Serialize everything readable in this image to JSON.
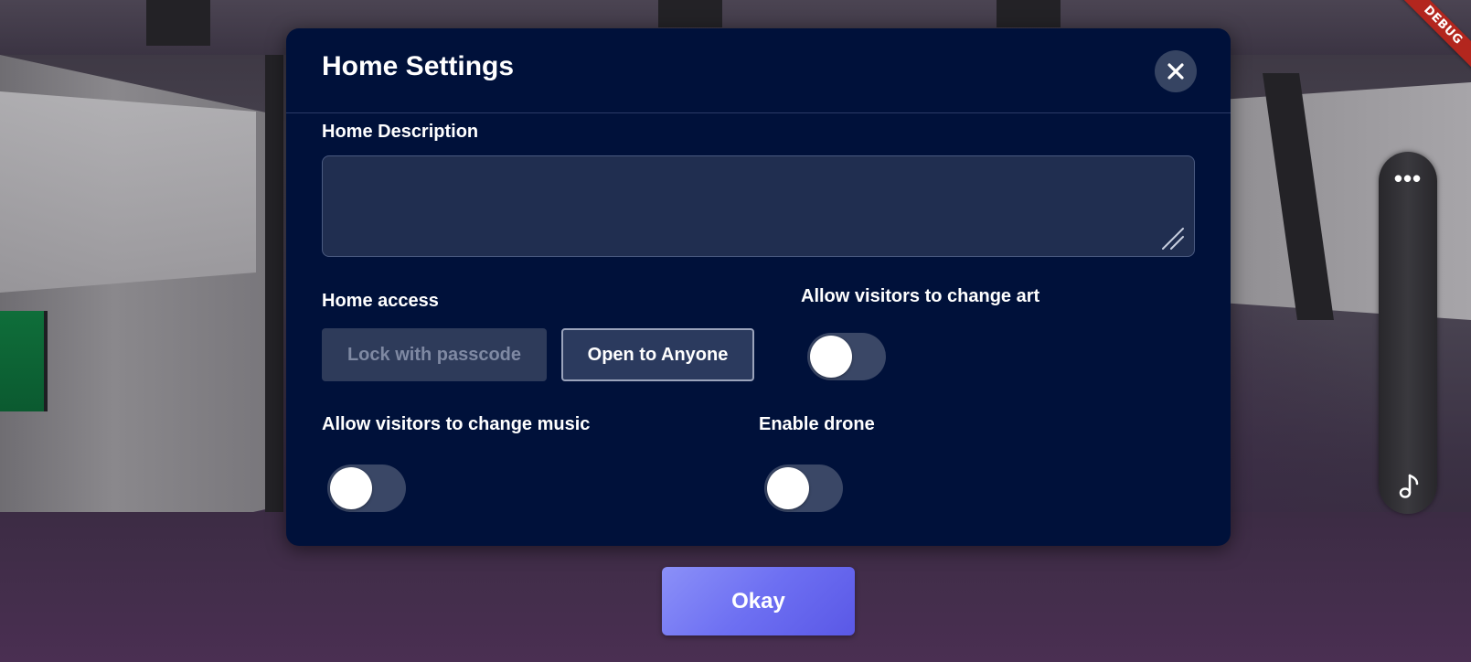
{
  "debug_banner": "DEBUG",
  "dialog": {
    "title": "Home Settings",
    "description": {
      "label": "Home Description",
      "value": "",
      "placeholder": ""
    },
    "access": {
      "label": "Home access",
      "lock_label": "Lock with passcode",
      "open_label": "Open to Anyone",
      "selected": "Open to Anyone"
    },
    "toggles": {
      "change_art": {
        "label": "Allow visitors to change art",
        "on": false
      },
      "change_music": {
        "label": "Allow visitors to change music",
        "on": false
      },
      "drone": {
        "label": "Enable drone",
        "on": false
      }
    }
  },
  "okay_label": "Okay",
  "side_toolbar": {
    "icons": [
      "more-options-icon",
      "music-note-icon"
    ]
  },
  "colors": {
    "dialog_bg": "#00113a",
    "okay_gradient_start": "#8b90f8",
    "okay_gradient_end": "#5a58e6",
    "debug_banner": "#b3261e"
  }
}
